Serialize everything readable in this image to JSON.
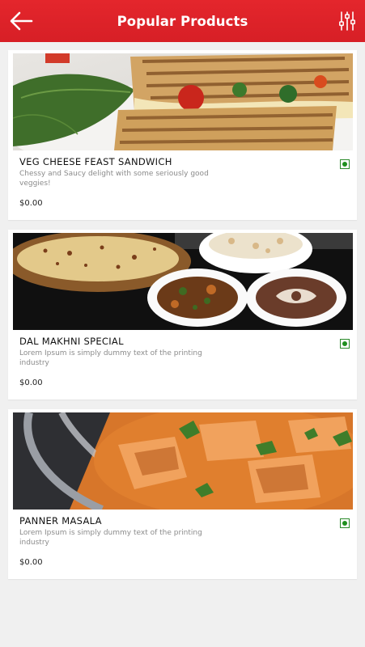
{
  "header": {
    "title": "Popular Products",
    "back_icon": "arrow-left-icon",
    "filter_icon": "sliders-icon",
    "background": "#d9232a"
  },
  "products": [
    {
      "name": "VEG CHEESE FEAST SANDWICH",
      "description": "Chessy and Saucy delight with some seriously good veggies!",
      "price": "$0.00",
      "veg_indicator": "veg-icon",
      "image": "sandwich-photo"
    },
    {
      "name": "DAL MAKHNI SPECIAL",
      "description": "Lorem Ipsum is simply dummy text of the printing industry",
      "price": "$0.00",
      "veg_indicator": "veg-icon",
      "image": "dal-makhni-photo"
    },
    {
      "name": "PANNER MASALA",
      "description": "Lorem Ipsum is simply dummy text of the printing industry",
      "price": "$0.00",
      "veg_indicator": "veg-icon",
      "image": "paneer-masala-photo"
    }
  ],
  "colors": {
    "accent": "#d9232a",
    "veg_green": "#1e8f1e",
    "background": "#f0f0f0"
  }
}
